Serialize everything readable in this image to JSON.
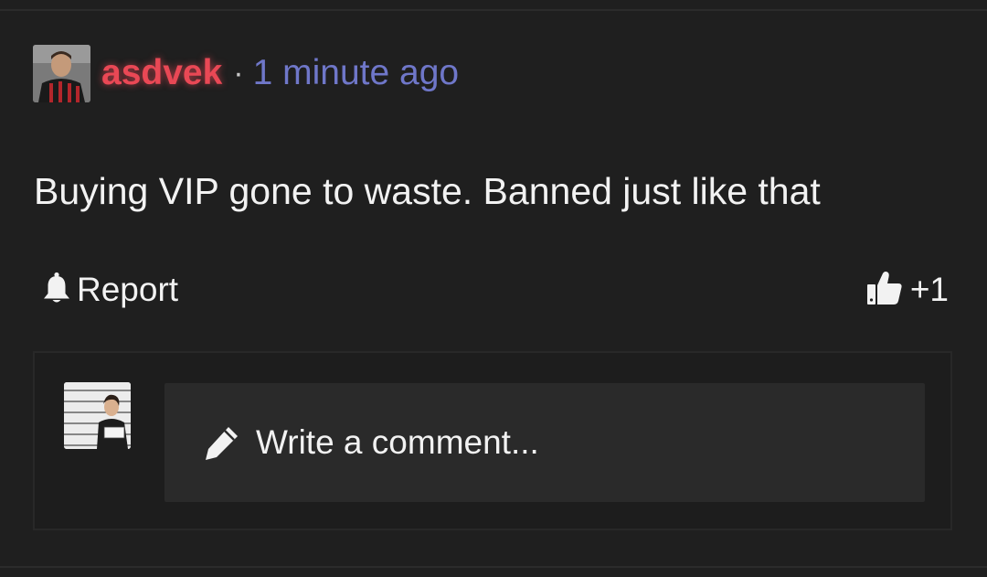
{
  "post": {
    "username": "asdvek",
    "separator": "·",
    "timestamp": "1 minute ago",
    "body": "Buying VIP gone to waste. Banned just like that",
    "report_label": "Report",
    "like_count": "+1"
  },
  "comment": {
    "placeholder": "Write a comment..."
  },
  "colors": {
    "background": "#1f1f1f",
    "username": "#e94855",
    "timestamp": "#6f77c9",
    "input_bg": "#2a2a2a"
  },
  "icons": {
    "report": "bell-icon",
    "like": "thumbs-up-icon",
    "comment": "pencil-icon"
  }
}
